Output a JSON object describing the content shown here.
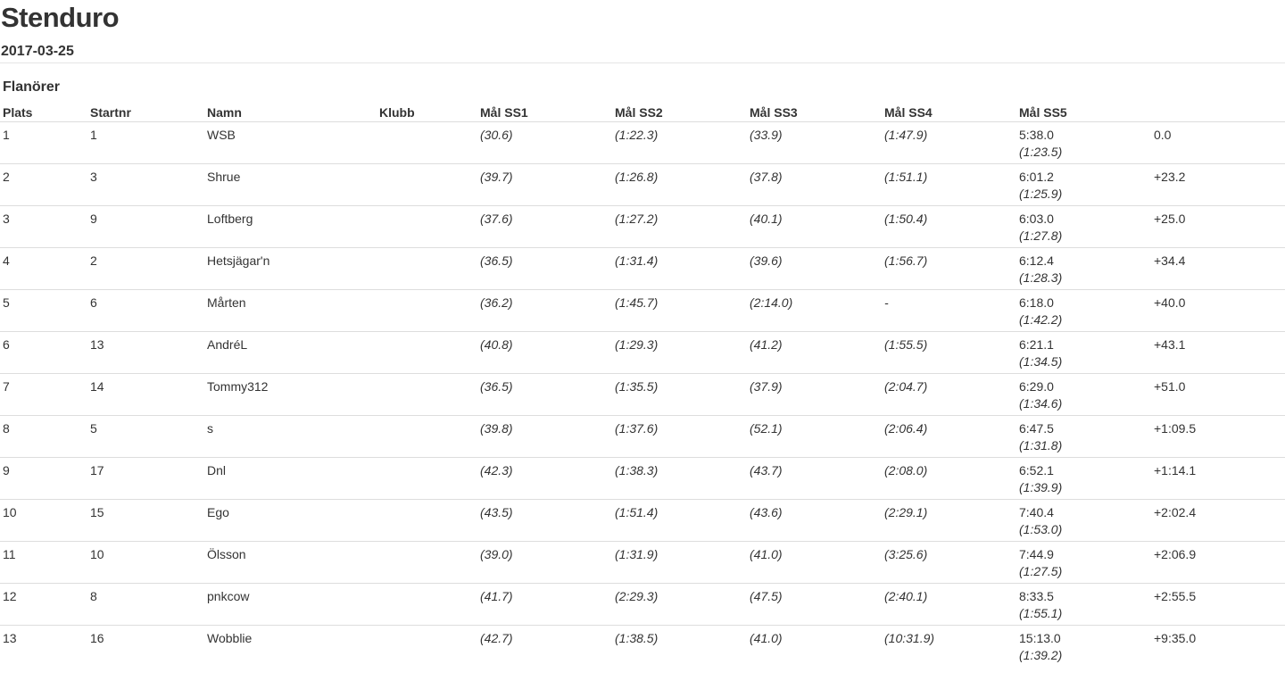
{
  "event": {
    "title": "Stenduro",
    "date": "2017-03-25"
  },
  "class_name": "Flanörer",
  "columns": {
    "plats": "Plats",
    "startnr": "Startnr",
    "namn": "Namn",
    "klubb": "Klubb",
    "ss1": "Mål SS1",
    "ss2": "Mål SS2",
    "ss3": "Mål SS3",
    "ss4": "Mål SS4",
    "ss5": "Mål SS5",
    "diff": ""
  },
  "rows": [
    {
      "plats": "1",
      "startnr": "1",
      "namn": "WSB",
      "klubb": "",
      "ss1": "(30.6)",
      "ss2": "(1:22.3)",
      "ss3": "(33.9)",
      "ss4": "(1:47.9)",
      "total": "5:38.0",
      "ss5": "(1:23.5)",
      "diff": "0.0"
    },
    {
      "plats": "2",
      "startnr": "3",
      "namn": "Shrue",
      "klubb": "",
      "ss1": "(39.7)",
      "ss2": "(1:26.8)",
      "ss3": "(37.8)",
      "ss4": "(1:51.1)",
      "total": "6:01.2",
      "ss5": "(1:25.9)",
      "diff": "+23.2"
    },
    {
      "plats": "3",
      "startnr": "9",
      "namn": "Loftberg",
      "klubb": "",
      "ss1": "(37.6)",
      "ss2": "(1:27.2)",
      "ss3": "(40.1)",
      "ss4": "(1:50.4)",
      "total": "6:03.0",
      "ss5": "(1:27.8)",
      "diff": "+25.0"
    },
    {
      "plats": "4",
      "startnr": "2",
      "namn": "Hetsjägar'n",
      "klubb": "",
      "ss1": "(36.5)",
      "ss2": "(1:31.4)",
      "ss3": "(39.6)",
      "ss4": "(1:56.7)",
      "total": "6:12.4",
      "ss5": "(1:28.3)",
      "diff": "+34.4"
    },
    {
      "plats": "5",
      "startnr": "6",
      "namn": "Mårten",
      "klubb": "",
      "ss1": "(36.2)",
      "ss2": "(1:45.7)",
      "ss3": "(2:14.0)",
      "ss4": "-",
      "total": "6:18.0",
      "ss5": "(1:42.2)",
      "diff": "+40.0"
    },
    {
      "plats": "6",
      "startnr": "13",
      "namn": "AndréL",
      "klubb": "",
      "ss1": "(40.8)",
      "ss2": "(1:29.3)",
      "ss3": "(41.2)",
      "ss4": "(1:55.5)",
      "total": "6:21.1",
      "ss5": "(1:34.5)",
      "diff": "+43.1"
    },
    {
      "plats": "7",
      "startnr": "14",
      "namn": "Tommy312",
      "klubb": "",
      "ss1": "(36.5)",
      "ss2": "(1:35.5)",
      "ss3": "(37.9)",
      "ss4": "(2:04.7)",
      "total": "6:29.0",
      "ss5": "(1:34.6)",
      "diff": "+51.0"
    },
    {
      "plats": "8",
      "startnr": "5",
      "namn": "s",
      "klubb": "",
      "ss1": "(39.8)",
      "ss2": "(1:37.6)",
      "ss3": "(52.1)",
      "ss4": "(2:06.4)",
      "total": "6:47.5",
      "ss5": "(1:31.8)",
      "diff": "+1:09.5"
    },
    {
      "plats": "9",
      "startnr": "17",
      "namn": "Dnl",
      "klubb": "",
      "ss1": "(42.3)",
      "ss2": "(1:38.3)",
      "ss3": "(43.7)",
      "ss4": "(2:08.0)",
      "total": "6:52.1",
      "ss5": "(1:39.9)",
      "diff": "+1:14.1"
    },
    {
      "plats": "10",
      "startnr": "15",
      "namn": "Ego",
      "klubb": "",
      "ss1": "(43.5)",
      "ss2": "(1:51.4)",
      "ss3": "(43.6)",
      "ss4": "(2:29.1)",
      "total": "7:40.4",
      "ss5": "(1:53.0)",
      "diff": "+2:02.4"
    },
    {
      "plats": "11",
      "startnr": "10",
      "namn": "Ölsson",
      "klubb": "",
      "ss1": "(39.0)",
      "ss2": "(1:31.9)",
      "ss3": "(41.0)",
      "ss4": "(3:25.6)",
      "total": "7:44.9",
      "ss5": "(1:27.5)",
      "diff": "+2:06.9"
    },
    {
      "plats": "12",
      "startnr": "8",
      "namn": "pnkcow",
      "klubb": "",
      "ss1": "(41.7)",
      "ss2": "(2:29.3)",
      "ss3": "(47.5)",
      "ss4": "(2:40.1)",
      "total": "8:33.5",
      "ss5": "(1:55.1)",
      "diff": "+2:55.5"
    },
    {
      "plats": "13",
      "startnr": "16",
      "namn": "Wobblie",
      "klubb": "",
      "ss1": "(42.7)",
      "ss2": "(1:38.5)",
      "ss3": "(41.0)",
      "ss4": "(10:31.9)",
      "total": "15:13.0",
      "ss5": "(1:39.2)",
      "diff": "+9:35.0"
    }
  ]
}
